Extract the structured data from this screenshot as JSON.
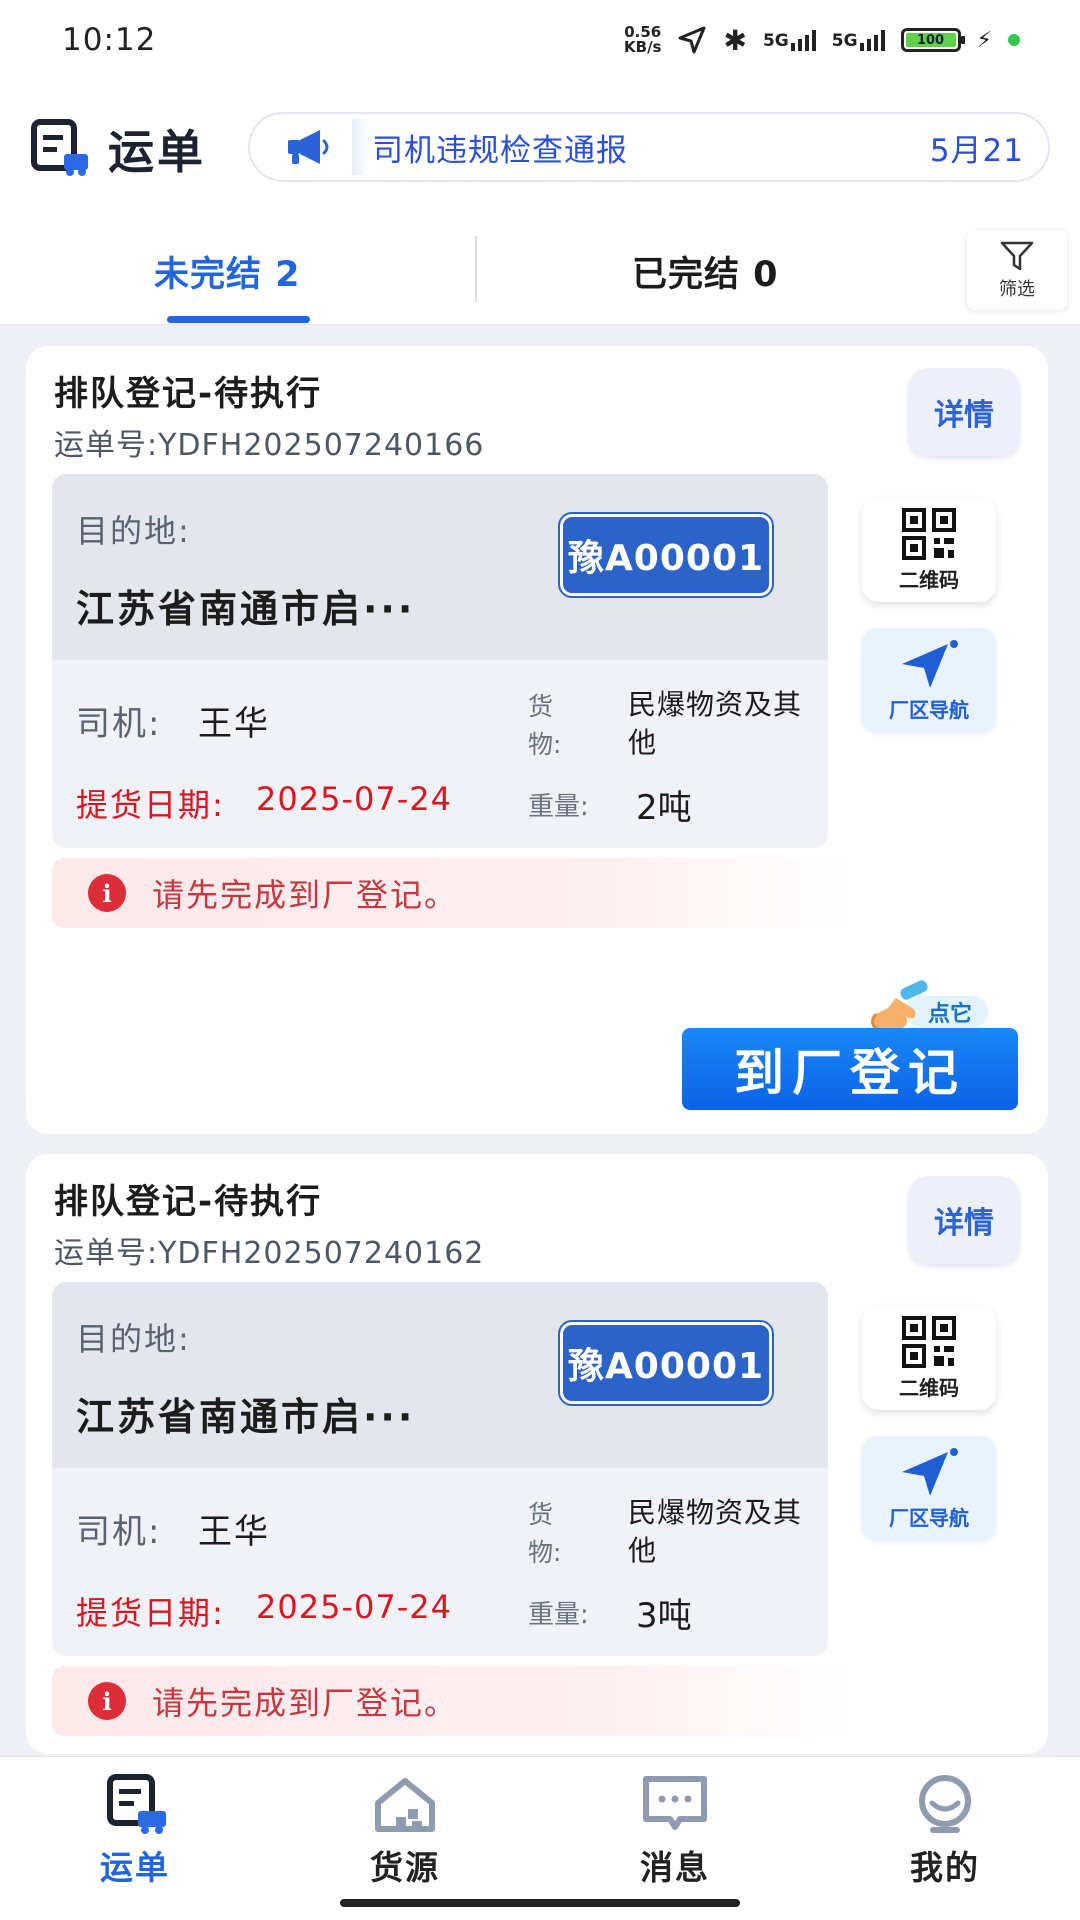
{
  "status_bar": {
    "time": "10:12",
    "net_speed_value": "0.56",
    "net_speed_unit": "KB/s",
    "signal_1": "5G",
    "signal_2": "5G",
    "battery": "100"
  },
  "header": {
    "title": "运单",
    "notice_text": "司机违规检查通报",
    "notice_date": "5月21"
  },
  "tabs": {
    "active_label": "未完结 2",
    "inactive_label": "已完结 0",
    "filter_label": "筛选"
  },
  "orders": [
    {
      "status": "排队登记-待执行",
      "waybill": "运单号:YDFH202507240166",
      "detail_label": "详情",
      "dest_label": "目的地:",
      "dest_value": "江苏省南通市启···",
      "plate": "豫A00001",
      "driver_label": "司机:",
      "driver_value": "王华",
      "goods_label": "货物:",
      "goods_value": "民爆物资及其他",
      "pickup_label": "提货日期:",
      "pickup_value": "2025-07-24",
      "weight_label": "重量:",
      "weight_value": "2吨",
      "qr_label": "二维码",
      "nav_label": "厂区导航",
      "alert": "请先完成到厂登记。",
      "register_button": "到厂登记",
      "hint": "点它"
    },
    {
      "status": "排队登记-待执行",
      "waybill": "运单号:YDFH202507240162",
      "detail_label": "详情",
      "dest_label": "目的地:",
      "dest_value": "江苏省南通市启···",
      "plate": "豫A00001",
      "driver_label": "司机:",
      "driver_value": "王华",
      "goods_label": "货物:",
      "goods_value": "民爆物资及其他",
      "pickup_label": "提货日期:",
      "pickup_value": "2025-07-24",
      "weight_label": "重量:",
      "weight_value": "3吨",
      "qr_label": "二维码",
      "nav_label": "厂区导航",
      "alert": "请先完成到厂登记。"
    }
  ],
  "bottom_nav": [
    {
      "label": "运单",
      "icon": "waybill-icon",
      "active": true
    },
    {
      "label": "货源",
      "icon": "cargo-source-icon",
      "active": false
    },
    {
      "label": "消息",
      "icon": "message-icon",
      "active": false
    },
    {
      "label": "我的",
      "icon": "profile-icon",
      "active": false
    }
  ],
  "colors": {
    "accent": "#1f66e0",
    "danger": "#e0141e",
    "plate": "#2c63c8"
  }
}
